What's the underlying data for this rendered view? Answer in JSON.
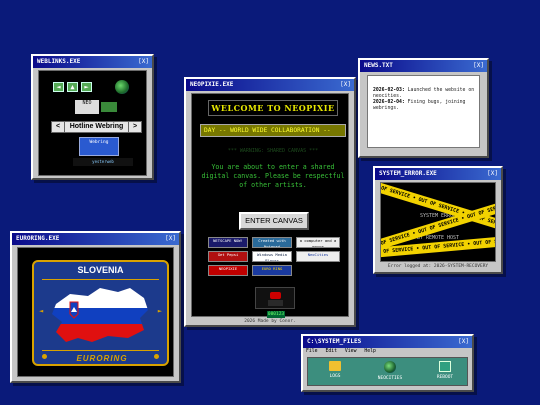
{
  "weblinks": {
    "title": "WEBLINKS.EXE",
    "close": "[X]",
    "webring_prev": "<",
    "webring_label": "Hotline Webring",
    "webring_next": ">",
    "badge_top": "NEO",
    "badge_mid": "Webring",
    "badge_bottom": "yesterweb"
  },
  "main": {
    "title": "NEOPIXIE.EXE",
    "close": "[X]",
    "welcome": "WELCOME TO NEOPIXIE",
    "ticker": "DAY -- WORLD WIDE COLLABORATION --",
    "dim_line": "*** WARNING: SHARED CANVAS ***",
    "warning": "You are about to enter a shared digital canvas. Please be respectful of other artists.",
    "enter_button": "ENTER CANVAS",
    "badges": [
      {
        "label": "NETSCAPE NOW!",
        "bg": "#1a1a6a",
        "fg": "#fff"
      },
      {
        "label": "Created with Notepad",
        "bg": "#2a6a9a",
        "fg": "#fff"
      },
      {
        "label": "a computer and a mouse",
        "bg": "#eeeeee",
        "fg": "#000"
      },
      {
        "label": "Get Pepsi",
        "bg": "#b01010",
        "fg": "#fff"
      },
      {
        "label": "Windows Media Player",
        "bg": "#ffffff",
        "fg": "#124"
      },
      {
        "label": "NeoCities",
        "bg": "#eeeeee",
        "fg": "#1a3aa0"
      },
      {
        "label": "NEOPIXIE",
        "bg": "#c00000",
        "fg": "#fff"
      },
      {
        "label": "EURO RING",
        "bg": "#1a3aa0",
        "fg": "#ffd800"
      }
    ],
    "counter": "000123",
    "footer": "2026 Made by Conor."
  },
  "news": {
    "title": "NEWS.TXT",
    "close": "[X]",
    "entries": [
      {
        "date": "2026-02-03:",
        "text": "Launched the website on neocities."
      },
      {
        "date": "2026-02-04:",
        "text": "Fixing bugs, joining webrings."
      }
    ]
  },
  "error": {
    "title": "SYSTEM_ERROR.EXE",
    "close": "[X]",
    "tape_text": "OUT OF SERVICE • OUT OF SERVICE • OUT OF SERVICE •",
    "underlay": "SYSTEM ERROR",
    "underlay2": "BY REMOTE HOST",
    "footer": "Error logged at: 2026-SYSTEM-RECOVERY"
  },
  "euroring": {
    "title": "EURORING.EXE",
    "close": "[X]",
    "country": "SLOVENIA",
    "logo": "EURORING",
    "prev": "◄",
    "next": "►"
  },
  "files": {
    "title": "C:\\SYSTEM_FILES",
    "close": "[X]",
    "menu": [
      "File",
      "Edit",
      "View",
      "Help"
    ],
    "items": [
      {
        "label": "LOGS"
      },
      {
        "label": "NEOCITIES"
      },
      {
        "label": "REBOOT"
      }
    ]
  }
}
